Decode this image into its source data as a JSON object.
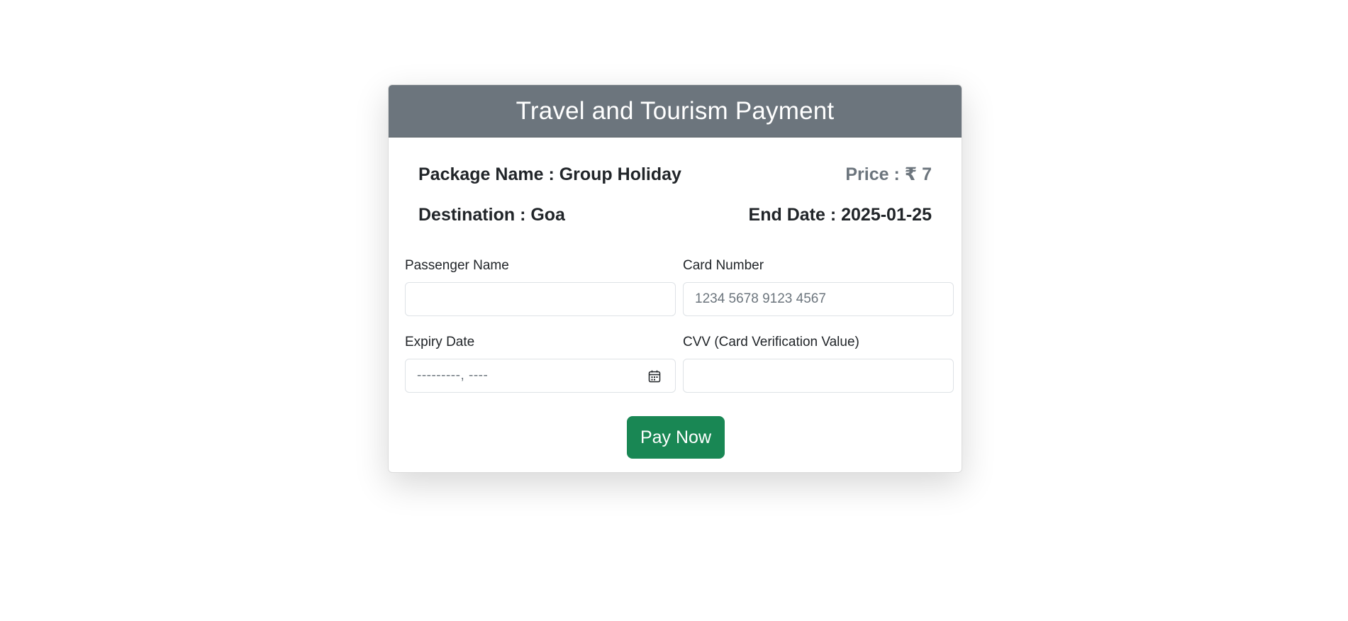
{
  "card": {
    "title": "Travel and Tourism Payment",
    "package_text": "Package Name : Group Holiday",
    "price_text": "Price : ₹ 7",
    "destination_text": "Destination : Goa",
    "end_date_text": "End Date : 2025-01-25"
  },
  "form": {
    "passenger_name": {
      "label": "Passenger Name",
      "value": "",
      "placeholder": ""
    },
    "card_number": {
      "label": "Card Number",
      "value": "",
      "placeholder": "1234 5678 9123 4567"
    },
    "expiry_date": {
      "label": "Expiry Date",
      "display": "---------, ----",
      "icon": "calendar-icon"
    },
    "cvv": {
      "label": "CVV (Card Verification Value)",
      "value": "",
      "placeholder": ""
    },
    "submit_label": "Pay Now"
  },
  "colors": {
    "header_bg": "#6c757d",
    "button_bg": "#198754",
    "price_text": "#6c757d"
  }
}
